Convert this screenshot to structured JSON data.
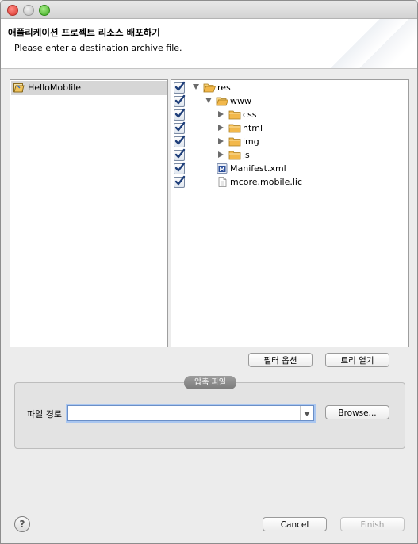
{
  "window": {
    "title": "애플리케이션 프로젝트 리소스 배포하기",
    "subtitle": "Please enter a destination archive file."
  },
  "projects": [
    {
      "label": "HelloMoblile",
      "selected": true
    }
  ],
  "tree": [
    {
      "label": "res",
      "checked": true,
      "expanded": true,
      "icon": "folder-open-icon",
      "depth": 0,
      "has_children": true
    },
    {
      "label": "www",
      "checked": true,
      "expanded": true,
      "icon": "folder-open-icon",
      "depth": 1,
      "has_children": true
    },
    {
      "label": "css",
      "checked": true,
      "expanded": false,
      "icon": "folder-icon",
      "depth": 2,
      "has_children": true
    },
    {
      "label": "html",
      "checked": true,
      "expanded": false,
      "icon": "folder-icon",
      "depth": 2,
      "has_children": true
    },
    {
      "label": "img",
      "checked": true,
      "expanded": false,
      "icon": "folder-icon",
      "depth": 2,
      "has_children": true
    },
    {
      "label": "js",
      "checked": true,
      "expanded": false,
      "icon": "folder-icon",
      "depth": 2,
      "has_children": true
    },
    {
      "label": "Manifest.xml",
      "checked": true,
      "expanded": false,
      "icon": "manifest-file-icon",
      "depth": 1,
      "has_children": false
    },
    {
      "label": "mcore.mobile.lic",
      "checked": true,
      "expanded": false,
      "icon": "file-icon",
      "depth": 1,
      "has_children": false
    }
  ],
  "actions": {
    "filter_options": "필터 옵션",
    "open_tree": "트리 열기"
  },
  "archive": {
    "group_label": "압축 파일",
    "path_label": "파일 경로",
    "path_value": "",
    "browse": "Browse..."
  },
  "footer": {
    "help": "?",
    "cancel": "Cancel",
    "finish": "Finish"
  },
  "colors": {
    "checkbox_check": "#1f3f7a",
    "folder": "#f2b84b",
    "selection": "#d6d6d6"
  }
}
